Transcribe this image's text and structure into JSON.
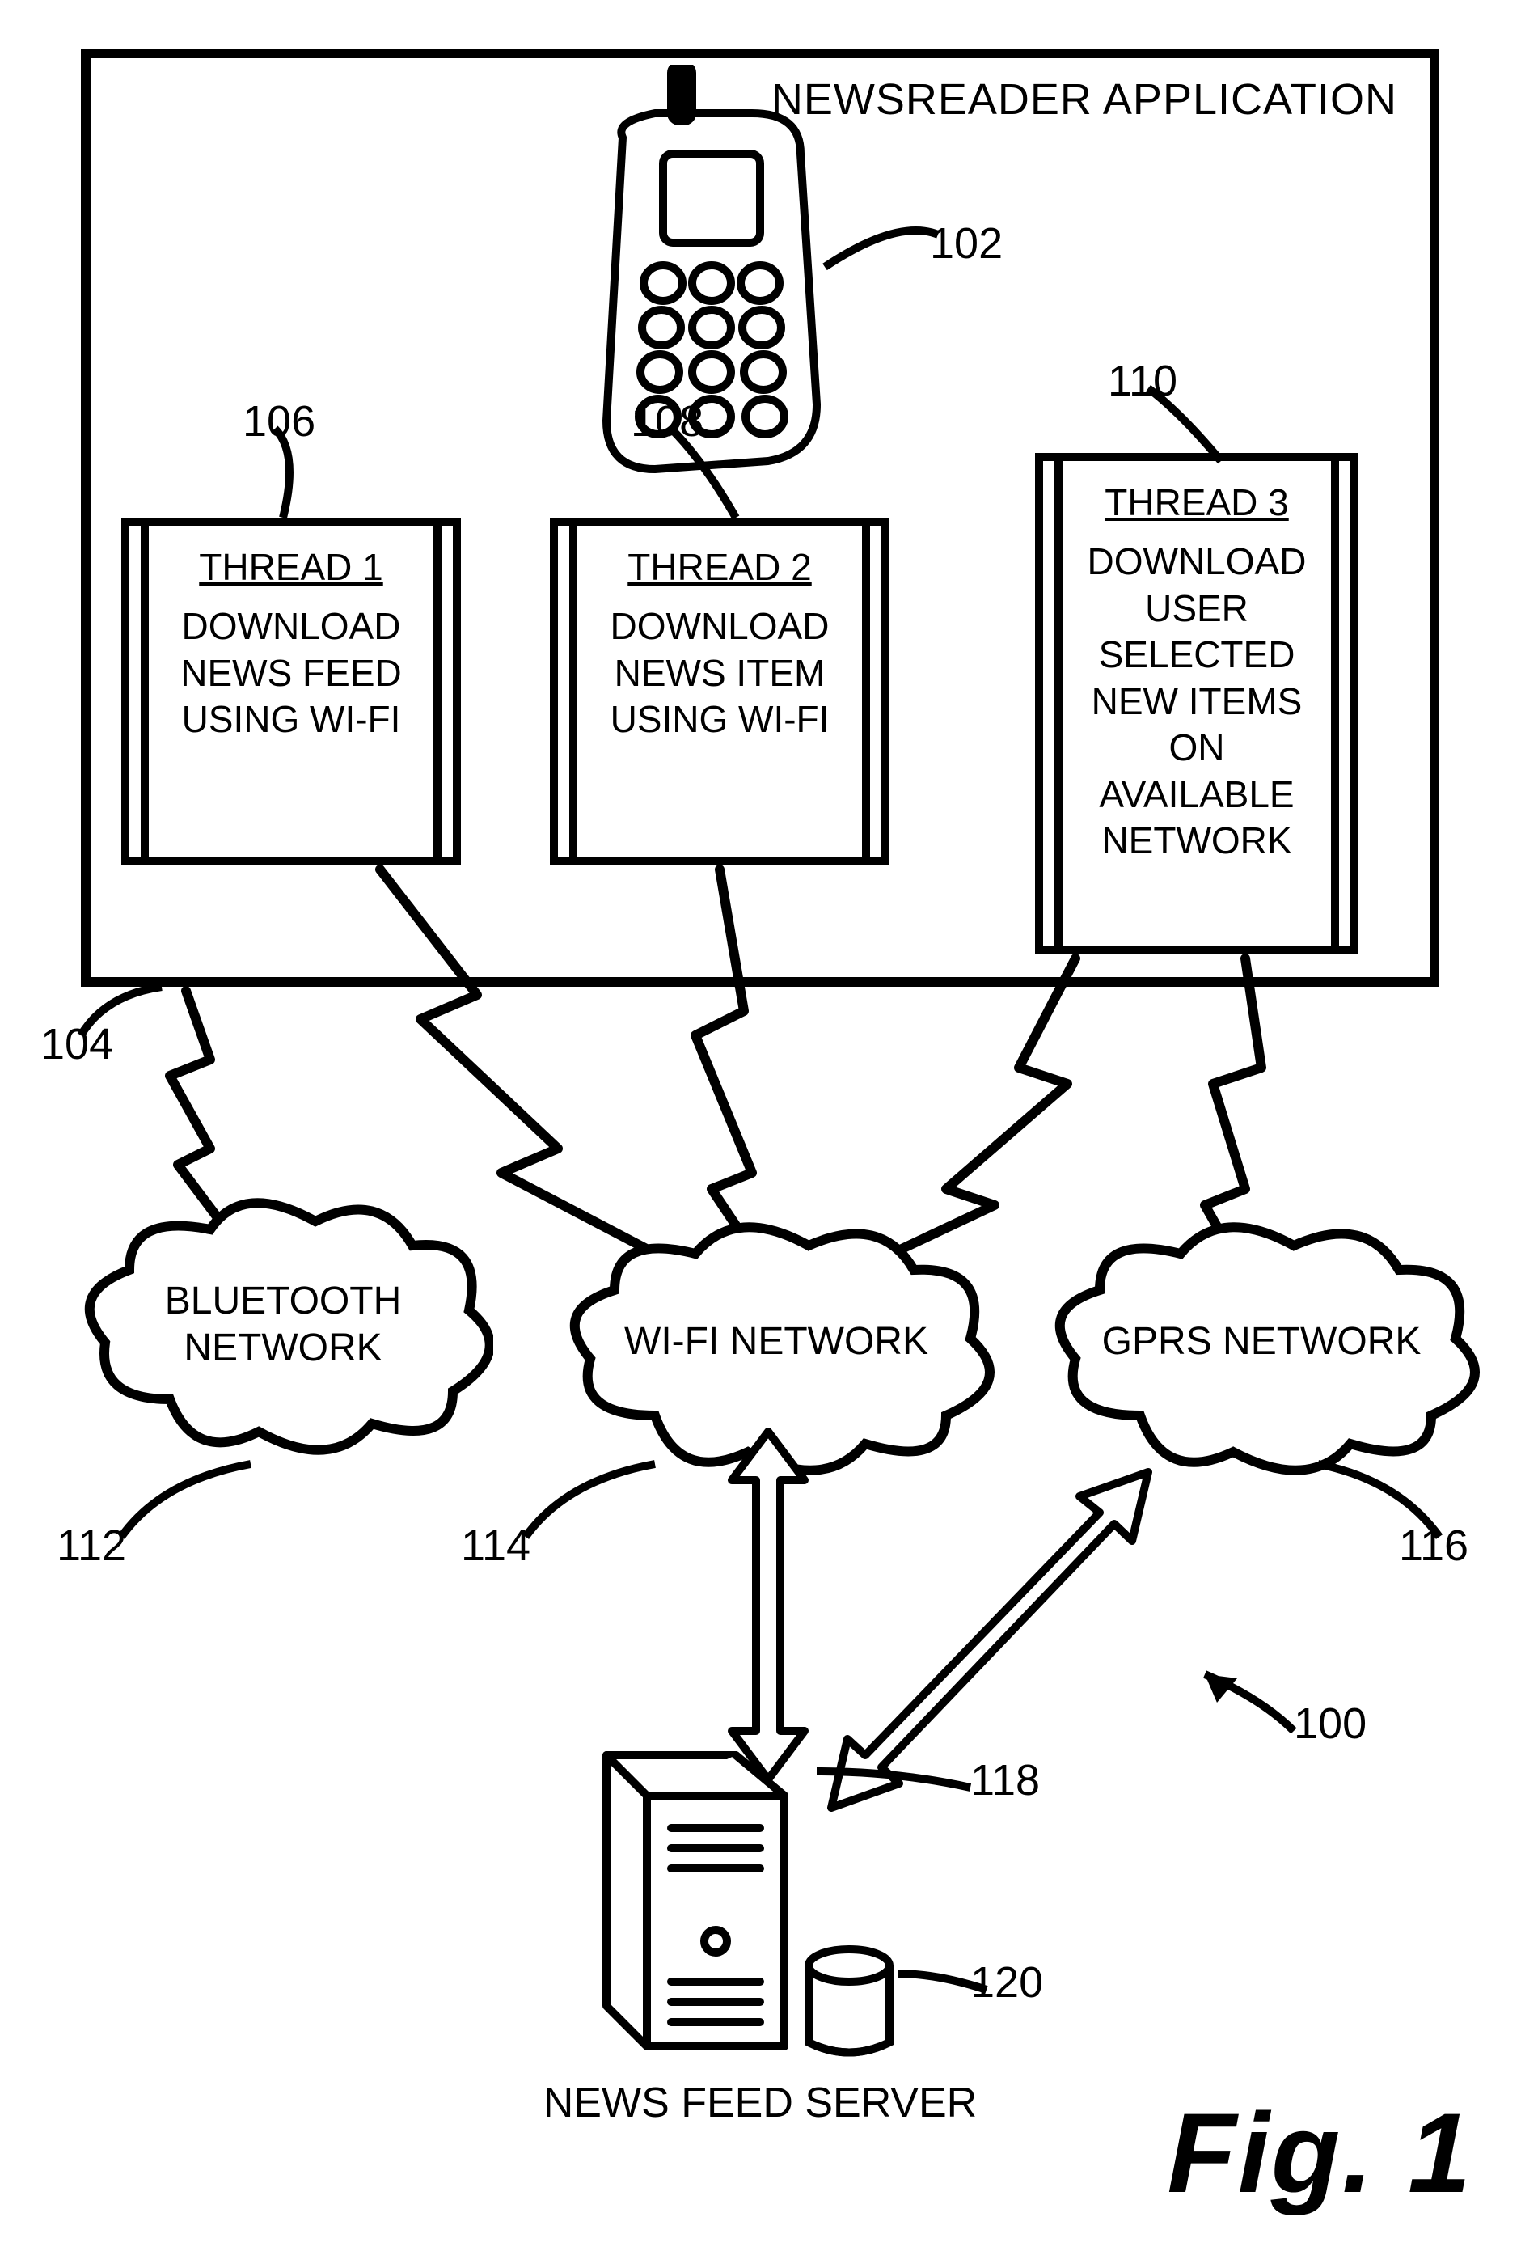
{
  "app": {
    "title": "NEWSREADER APPLICATION"
  },
  "refs": {
    "figure": "100",
    "phone": "102",
    "appbox": "104",
    "thread1": "106",
    "thread2": "108",
    "thread3": "110",
    "bluetooth": "112",
    "wifi": "114",
    "gprs": "116",
    "server": "118",
    "database": "120"
  },
  "threads": {
    "t1": {
      "title": "THREAD 1",
      "body": "DOWNLOAD NEWS FEED USING WI-FI"
    },
    "t2": {
      "title": "THREAD 2",
      "body": "DOWNLOAD NEWS ITEM USING WI-FI"
    },
    "t3": {
      "title": "THREAD 3",
      "body": "DOWNLOAD USER SELECTED NEW ITEMS ON AVAILABLE NETWORK"
    }
  },
  "clouds": {
    "bluetooth": "BLUETOOTH NETWORK",
    "wifi": "WI-FI NETWORK",
    "gprs": "GPRS NETWORK"
  },
  "server": {
    "label": "NEWS FEED SERVER"
  },
  "caption": "Fig. 1"
}
